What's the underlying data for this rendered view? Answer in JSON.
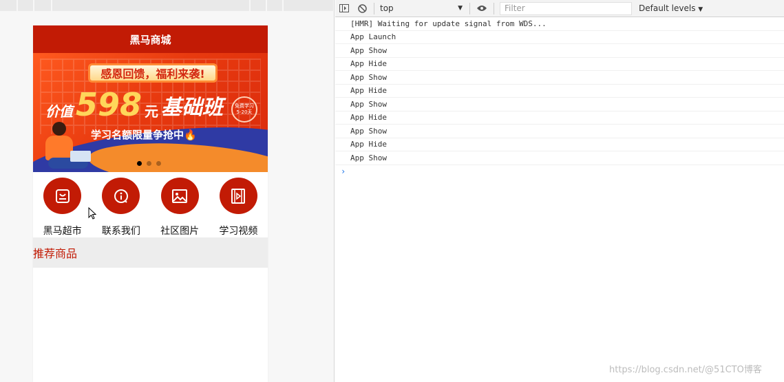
{
  "app": {
    "title": "黑马商城"
  },
  "banner": {
    "ribbon": "感恩回馈，福利来袭!",
    "price_label": "价值",
    "price_number": "598",
    "price_unit": "元",
    "course": "基础班",
    "badge_line1": "免费学习",
    "badge_line2": "5-20天",
    "slogan": "学习名额限量争抢中",
    "active_slide": 1,
    "slide_count": 3
  },
  "grid_nav": {
    "items": [
      {
        "label": "黑马超市",
        "icon": "bag-icon"
      },
      {
        "label": "联系我们",
        "icon": "info-icon"
      },
      {
        "label": "社区图片",
        "icon": "picture-icon"
      },
      {
        "label": "学习视频",
        "icon": "film-icon"
      }
    ]
  },
  "section": {
    "title": "推荐商品"
  },
  "devtools": {
    "context": "top",
    "filter_placeholder": "Filter",
    "levels": "Default levels",
    "logs": [
      "[HMR] Waiting for update signal from WDS...",
      "App Launch",
      "App Show",
      "App Hide",
      "App Show",
      "App Hide",
      "App Show",
      "App Hide",
      "App Show",
      "App Hide",
      "App Show"
    ]
  },
  "watermark": "https://blog.csdn.net/@51CTO博客",
  "colors": {
    "brand_red": "#c21b05",
    "section_bg": "#ededed"
  }
}
